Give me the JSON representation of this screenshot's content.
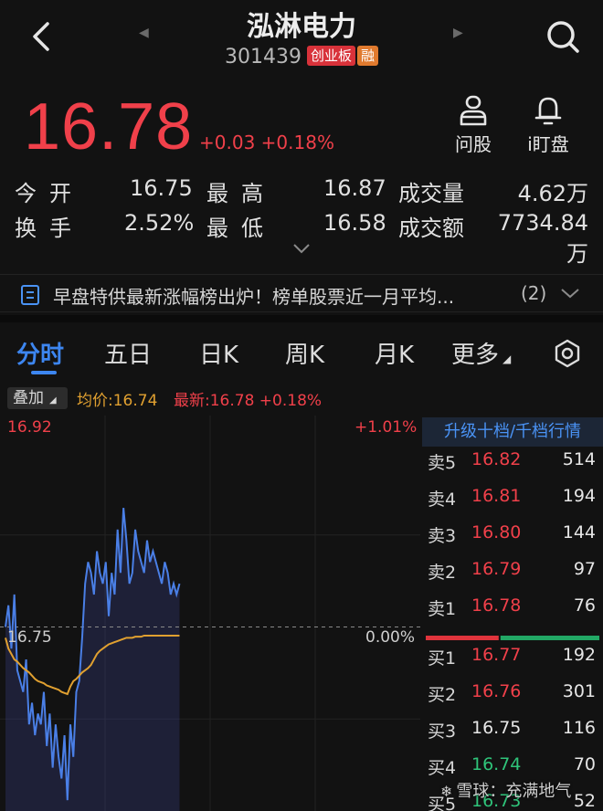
{
  "header": {
    "stock_name": "泓淋电力",
    "stock_code": "301439",
    "board_tag": "创业板",
    "margin_tag": "融"
  },
  "quote": {
    "price": "16.78",
    "change": "+0.03",
    "change_pct": "+0.18%"
  },
  "actions": [
    {
      "label": "问股",
      "icon": "person-icon"
    },
    {
      "label": "i盯盘",
      "icon": "bell-icon"
    }
  ],
  "stats": {
    "open_label": "今开",
    "open_value": "16.75",
    "high_label": "最高",
    "high_value": "16.87",
    "volume_label": "成交量",
    "volume_value": "4.62万",
    "turnover_label": "换手",
    "turnover_value": "2.52%",
    "low_label": "最低",
    "low_value": "16.58",
    "amount_label": "成交额",
    "amount_value": "7734.84万"
  },
  "news": {
    "text": "早盘特供最新涨幅榜出炉！榜单股票近一月平均...",
    "count": "(2)"
  },
  "tabs": [
    {
      "label": "分时",
      "active": true
    },
    {
      "label": "五日"
    },
    {
      "label": "日K"
    },
    {
      "label": "周K"
    },
    {
      "label": "月K"
    },
    {
      "label": "更多"
    }
  ],
  "overlay": {
    "button": "叠加",
    "avg_price": "均价:16.74",
    "latest": "最新:16.78 +0.18%"
  },
  "chart_data": {
    "type": "line",
    "y_top_label": "16.92",
    "y_top_pct": "+1.01%",
    "y_mid_label": "16.75",
    "y_mid_pct": "0.00%",
    "ylim": [
      16.58,
      16.92
    ],
    "base": 16.75,
    "series": [
      {
        "color": "#4a7fe6",
        "values": [
          16.75,
          16.77,
          16.73,
          16.78,
          16.71,
          16.7,
          16.69,
          16.72,
          16.66,
          16.68,
          16.65,
          16.67,
          16.66,
          16.69,
          16.64,
          16.67,
          16.62,
          16.66,
          16.63,
          16.61,
          16.65,
          16.59,
          16.66,
          16.63,
          16.69,
          16.7,
          16.74,
          16.79,
          16.81,
          16.8,
          16.78,
          16.82,
          16.8,
          16.79,
          16.81,
          16.76,
          16.8,
          16.78,
          16.84,
          16.8,
          16.86,
          16.83,
          16.79,
          16.8,
          16.84,
          16.82,
          16.81,
          16.8,
          16.83,
          16.81,
          16.82,
          16.81,
          16.8,
          16.79,
          16.81,
          16.8,
          16.78,
          16.79,
          16.78,
          16.79
        ]
      },
      {
        "color": "#e0a030",
        "values": [
          16.74,
          16.73,
          16.725,
          16.72,
          16.718,
          16.715,
          16.712,
          16.71,
          16.708,
          16.705,
          16.702,
          16.7,
          16.699,
          16.698,
          16.696,
          16.695,
          16.694,
          16.693,
          16.692,
          16.69,
          16.689,
          16.688,
          16.695,
          16.7,
          16.702,
          16.705,
          16.708,
          16.71,
          16.712,
          16.715,
          16.72,
          16.725,
          16.728,
          16.73,
          16.732,
          16.734,
          16.735,
          16.736,
          16.737,
          16.738,
          16.739,
          16.74,
          16.74,
          16.74,
          16.741,
          16.741,
          16.741,
          16.742,
          16.742,
          16.742,
          16.742,
          16.742,
          16.742,
          16.742,
          16.742,
          16.742,
          16.742,
          16.742,
          16.742,
          16.742
        ]
      }
    ]
  },
  "order_book": {
    "upgrade_label": "升级十档/千档行情",
    "rows": [
      {
        "label": "卖5",
        "price": "16.82",
        "volume": "514",
        "color": "red"
      },
      {
        "label": "卖4",
        "price": "16.81",
        "volume": "194",
        "color": "red"
      },
      {
        "label": "卖3",
        "price": "16.80",
        "volume": "144",
        "color": "red"
      },
      {
        "label": "卖2",
        "price": "16.79",
        "volume": "97",
        "color": "red"
      },
      {
        "label": "卖1",
        "price": "16.78",
        "volume": "76",
        "color": "red"
      },
      {
        "label": "买1",
        "price": "16.77",
        "volume": "192",
        "color": "red"
      },
      {
        "label": "买2",
        "price": "16.76",
        "volume": "301",
        "color": "red"
      },
      {
        "label": "买3",
        "price": "16.75",
        "volume": "116",
        "color": "white"
      },
      {
        "label": "买4",
        "price": "16.74",
        "volume": "70",
        "color": "green"
      },
      {
        "label": "买5",
        "price": "16.73",
        "volume": "52",
        "color": "green"
      }
    ],
    "sell_ratio": 0.42
  },
  "watermark": {
    "text": "雪球：充满地气"
  }
}
